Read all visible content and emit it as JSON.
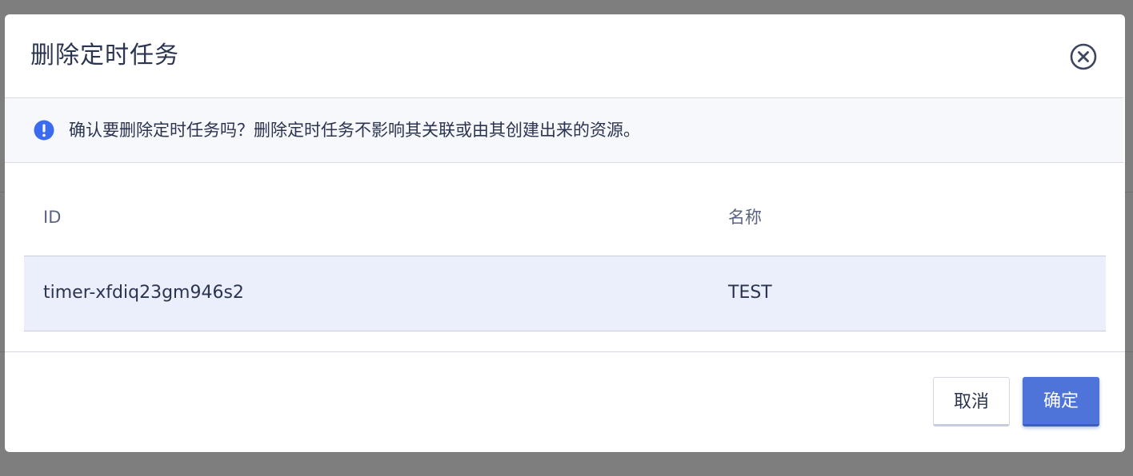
{
  "dialog": {
    "title": "删除定时任务",
    "close_icon": "close-circle-icon",
    "alert": {
      "icon": "exclamation-circle-icon",
      "text": "确认要删除定时任务吗？删除定时任务不影响其关联或由其创建出来的资源。",
      "icon_color": "#3b6cf0"
    },
    "table": {
      "columns": [
        "ID",
        "名称"
      ],
      "rows": [
        {
          "id": "timer-xfdiq23gm946s2",
          "name": "TEST"
        }
      ]
    },
    "buttons": {
      "cancel": "取消",
      "confirm": "确定"
    }
  },
  "colors": {
    "accent": "#4f74d9",
    "selected_row": "#eaeffb",
    "text": "#2b3450"
  }
}
